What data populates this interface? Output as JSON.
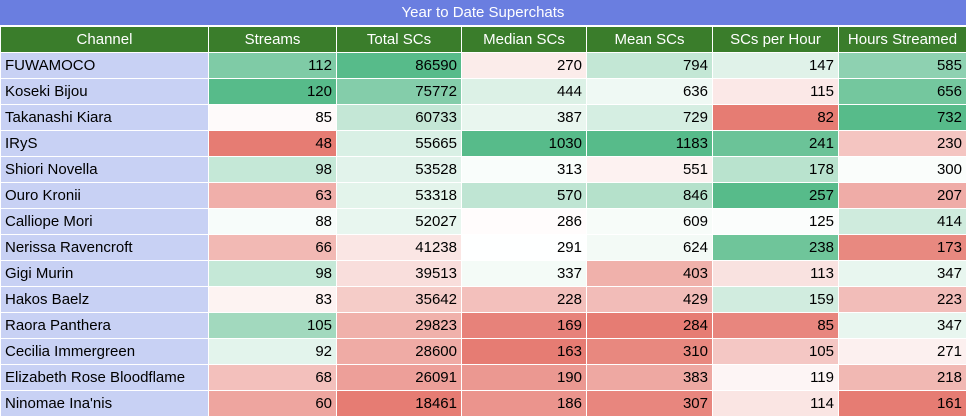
{
  "title": "Year to Date Superchats",
  "chart_data": {
    "type": "table",
    "title": "Year to Date Superchats",
    "columns": [
      "Channel",
      "Streams",
      "Total SCs",
      "Median SCs",
      "Mean SCs",
      "SCs per Hour",
      "Hours Streamed"
    ],
    "rows": [
      [
        "FUWAMOCO",
        112,
        86590,
        270,
        794,
        147,
        585
      ],
      [
        "Koseki Bijou",
        120,
        75772,
        444,
        636,
        115,
        656
      ],
      [
        "Takanashi Kiara",
        85,
        60733,
        387,
        729,
        82,
        732
      ],
      [
        "IRyS",
        48,
        55665,
        1030,
        1183,
        241,
        230
      ],
      [
        "Shiori Novella",
        98,
        53528,
        313,
        551,
        178,
        300
      ],
      [
        "Ouro Kronii",
        63,
        53318,
        570,
        846,
        257,
        207
      ],
      [
        "Calliope Mori",
        88,
        52027,
        286,
        609,
        125,
        414
      ],
      [
        "Nerissa Ravencroft",
        66,
        41238,
        291,
        624,
        238,
        173
      ],
      [
        "Gigi Murin",
        98,
        39513,
        337,
        403,
        113,
        347
      ],
      [
        "Hakos Baelz",
        83,
        35642,
        228,
        429,
        159,
        223
      ],
      [
        "Raora Panthera",
        105,
        29823,
        169,
        284,
        85,
        347
      ],
      [
        "Cecilia Immergreen",
        92,
        28600,
        163,
        310,
        105,
        271
      ],
      [
        "Elizabeth Rose Bloodflame",
        68,
        26091,
        190,
        383,
        119,
        218
      ],
      [
        "Ninomae Ina'nis",
        60,
        18461,
        186,
        307,
        114,
        161
      ]
    ],
    "color_scale": {
      "low": "#e67c73",
      "mid": "#ffffff",
      "high": "#57bb8a"
    }
  },
  "colors": {
    "title_bg": "#6a7ee0",
    "header_bg": "#3a7d2b",
    "channel_bg": "#c8d1f4"
  }
}
